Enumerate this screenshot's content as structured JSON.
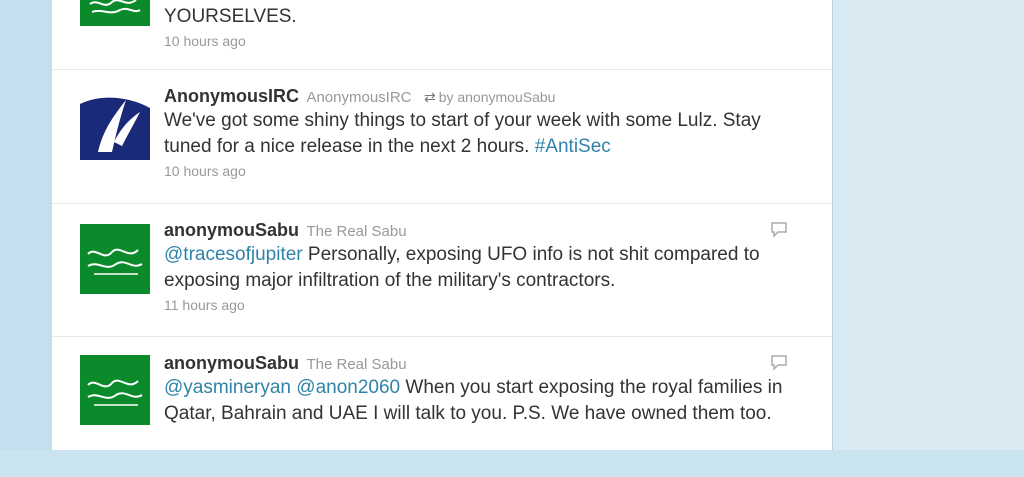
{
  "tweets": [
    {
      "text_tail": "YOURSELVES.",
      "time": "10 hours ago"
    },
    {
      "screen_name": "AnonymousIRC",
      "full_name": "AnonymousIRC",
      "retweet_text": "by anonymouSabu",
      "text": "We've got some shiny things to start of your week with some Lulz. Stay tuned for a nice release in the next 2 hours.",
      "hashtag": "#AntiSec",
      "time": "10 hours ago"
    },
    {
      "screen_name": "anonymouSabu",
      "full_name": "The Real Sabu",
      "mention1": "@tracesofjupiter",
      "text": "Personally, exposing UFO info is not shit compared to exposing major infiltration of the military's contractors.",
      "time": "11 hours ago"
    },
    {
      "screen_name": "anonymouSabu",
      "full_name": "The Real Sabu",
      "mention1": "@yasmineryan",
      "mention2": "@anon2060",
      "text": "When you start exposing the royal families in Qatar, Bahrain and UAE I will talk to you. P.S. We have owned them too."
    }
  ],
  "colors": {
    "link": "#2e83a8",
    "avatar_green": "#0a8a2a",
    "avatar_navy": "#1b2a78"
  },
  "icons": {
    "retweet": "retweet-icon",
    "reply": "reply-icon"
  }
}
